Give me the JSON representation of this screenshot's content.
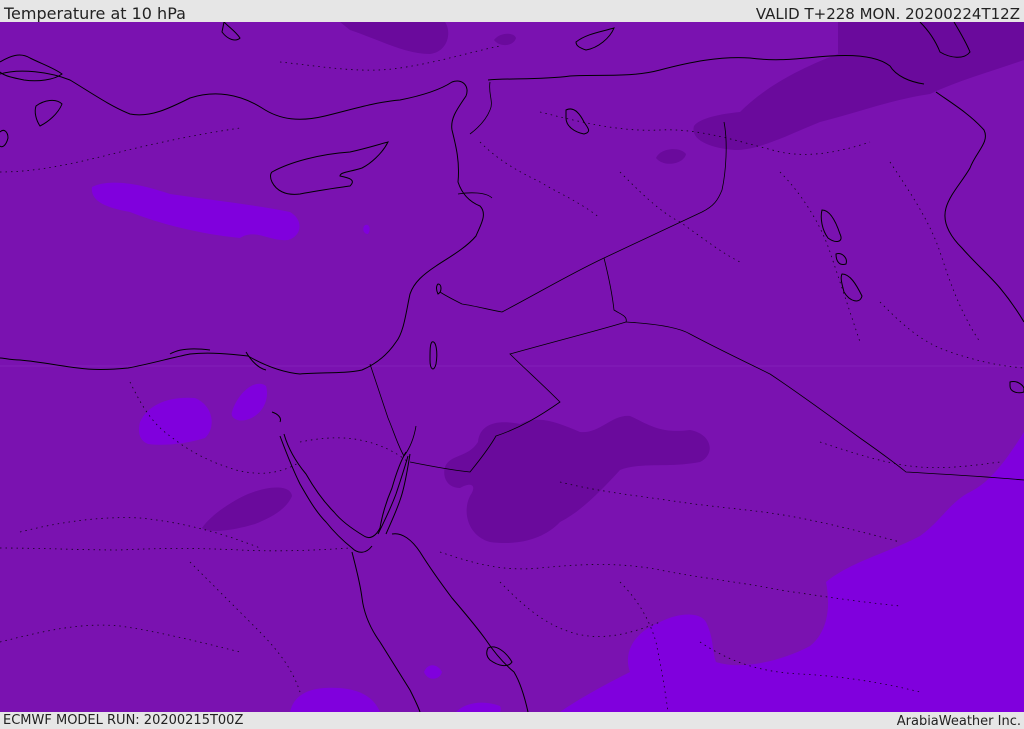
{
  "header": {
    "title": "Temperature at 10 hPa",
    "valid_time": "VALID T+228 MON. 20200224T12Z"
  },
  "footer": {
    "model_run": "ECMWF MODEL RUN: 20200215T00Z",
    "credit": "ArabiaWeather Inc."
  },
  "map": {
    "colors": {
      "base_fill": "#7a12b0",
      "warm_anomaly": "#6a0a9c",
      "cool_anomaly": "#8000dd",
      "coastline": "#000000"
    }
  }
}
